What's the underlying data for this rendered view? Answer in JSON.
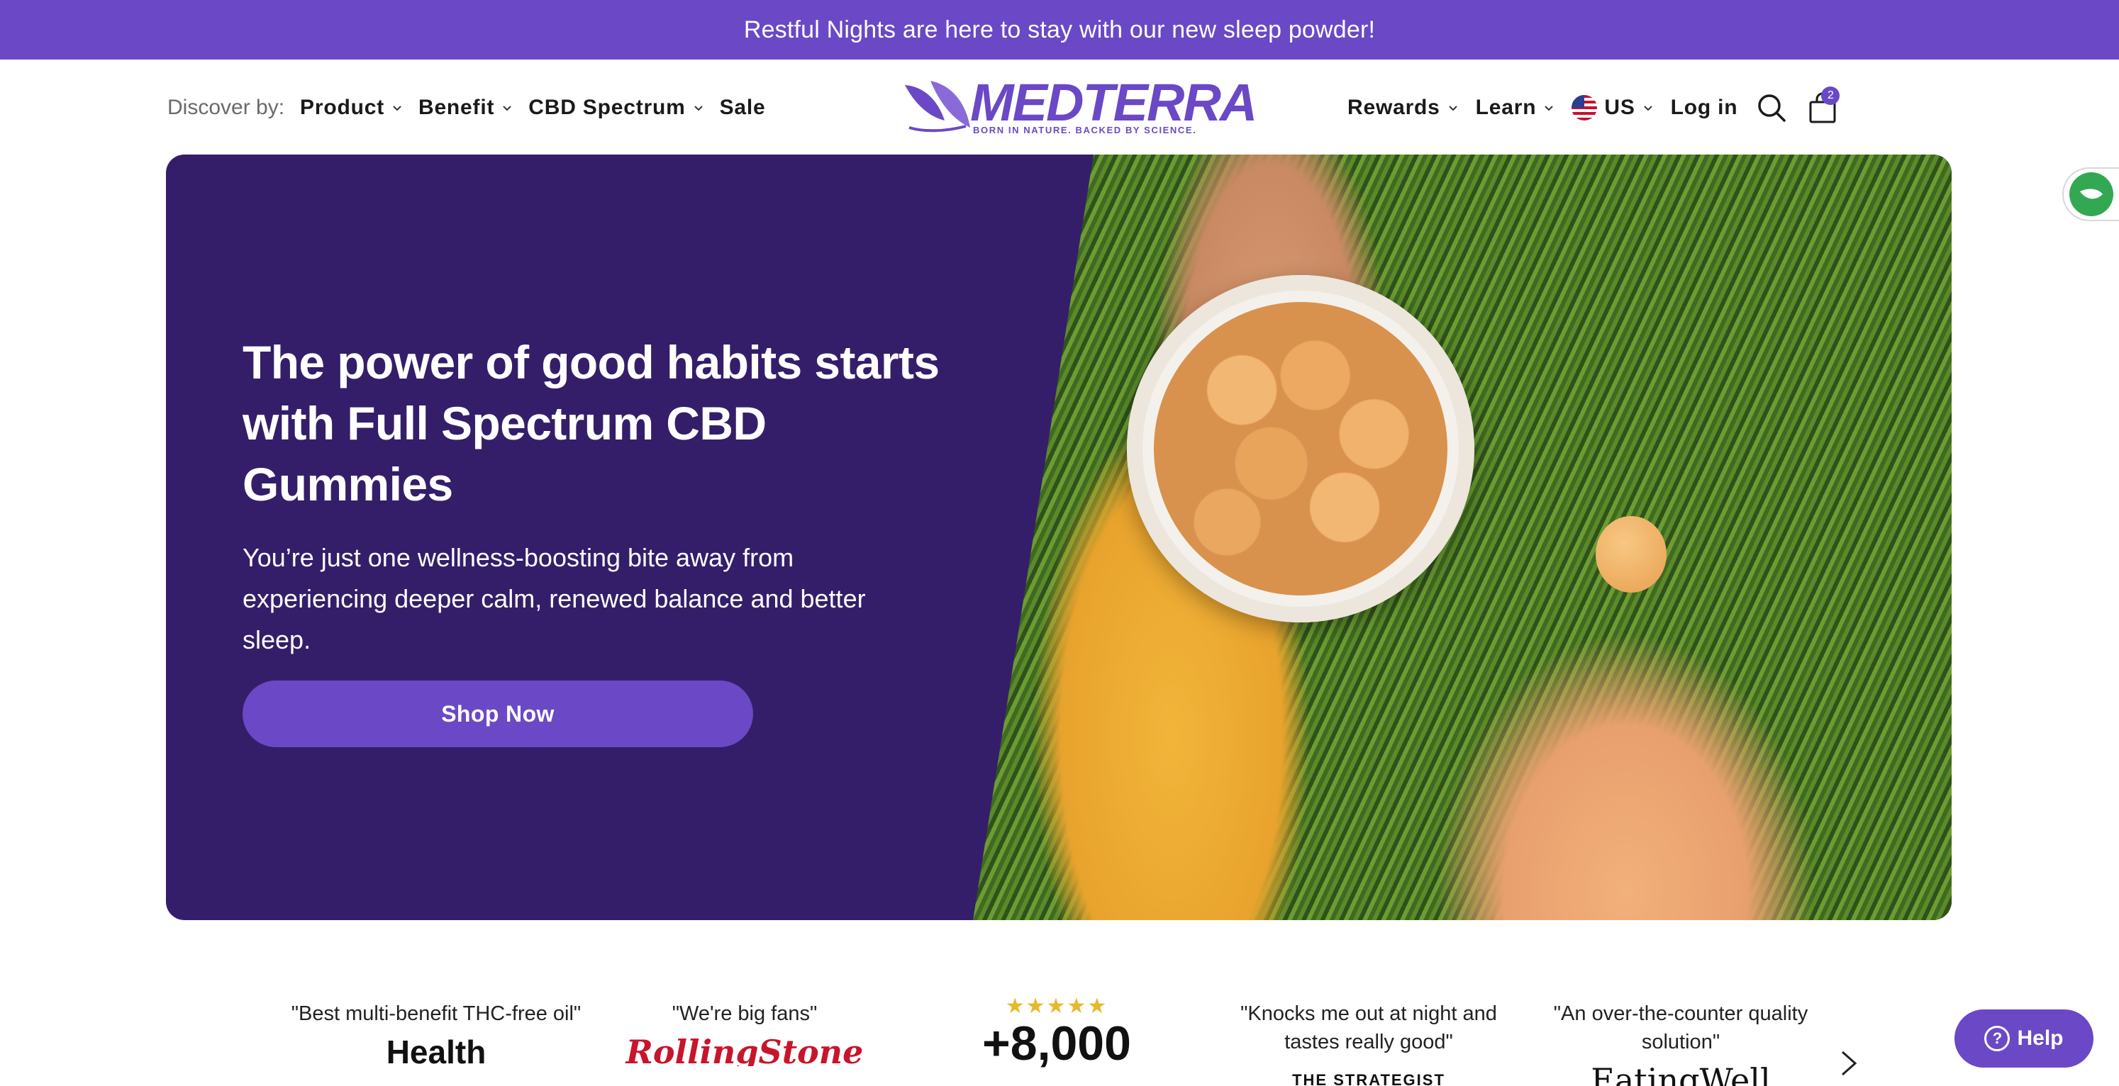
{
  "announcement": {
    "text": "Restful Nights are here to stay with our new sleep powder!"
  },
  "header": {
    "discover_label": "Discover by:",
    "nav_left": [
      {
        "label": "Product"
      },
      {
        "label": "Benefit"
      },
      {
        "label": "CBD Spectrum"
      },
      {
        "label": "Sale"
      }
    ],
    "logo": {
      "wordmark": "MEDTERRA",
      "tagline": "BORN IN NATURE. BACKED BY SCIENCE."
    },
    "nav_right": [
      {
        "label": "Rewards"
      },
      {
        "label": "Learn"
      }
    ],
    "region": "US",
    "login": "Log in",
    "cart_count": "2",
    "icons": {
      "search": "search-icon",
      "cart": "shopping-bag-icon",
      "flag": "us-flag-icon"
    }
  },
  "hero": {
    "title": "The power of good habits starts with Full Spectrum CBD Gummies",
    "subtitle": "You’re just one wellness-boosting bite away from experiencing deeper calm, renewed balance and better sleep.",
    "cta": "Shop Now"
  },
  "press": {
    "items": [
      {
        "quote": "\"Best multi-benefit THC-free oil\"",
        "logo": "Health"
      },
      {
        "quote": "\"We're big fans\"",
        "logo": "RollingStone"
      },
      {
        "quote": "\"Knocks me out at night and tastes really good\"",
        "logo": "THE STRATEGIST"
      },
      {
        "quote": "\"An over-the-counter quality solution\"",
        "logo": "EatingWell"
      }
    ],
    "rating": {
      "stars": "★★★★★",
      "count": "+8,000"
    }
  },
  "help": {
    "label": "Help"
  },
  "colors": {
    "brand": "#6b48c6",
    "hero_bg": "#341e6a",
    "star": "#e8b82d"
  }
}
